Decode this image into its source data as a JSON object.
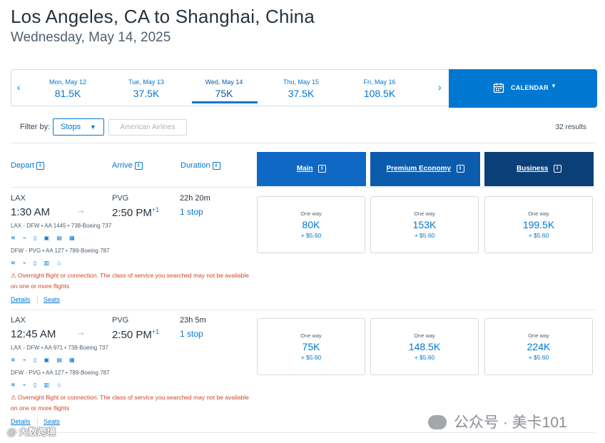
{
  "page": {
    "title": "Los Angeles, CA to Shanghai, China",
    "subtitle": "Wednesday, May 14, 2025"
  },
  "datebar": {
    "prev_glyph": "‹",
    "next_glyph": "›",
    "dates": [
      {
        "day": "Mon, May 12",
        "price": "81.5K"
      },
      {
        "day": "Tue, May 13",
        "price": "37.5K"
      },
      {
        "day": "Wed, May 14",
        "price": "75K"
      },
      {
        "day": "Thu, May 15",
        "price": "37.5K"
      },
      {
        "day": "Fri, May 16",
        "price": "108.5K"
      }
    ],
    "selected_index": 2,
    "calendar_label": "CALENDAR",
    "caret": "▼"
  },
  "filters": {
    "label": "Filter by:",
    "stops_value": "Stops",
    "caret": "▼",
    "airline_placeholder": "American Airlines",
    "results": "32 results"
  },
  "columns": {
    "depart": "Depart",
    "arrive": "Arrive",
    "duration": "Duration",
    "sort_glyph": "⇕",
    "cabins": [
      {
        "label": "Main",
        "color": "#0f68c4"
      },
      {
        "label": "Premium Economy",
        "color": "#0b5cad"
      },
      {
        "label": "Business",
        "color": "#0b3f78"
      }
    ]
  },
  "flights": [
    {
      "from": "LAX",
      "depart_time": "1:30 AM",
      "to": "PVG",
      "arrive_time": "2:50 PM",
      "day_offset": "+1",
      "duration": "22h 20m",
      "stops": "1 stop",
      "arrow": "→",
      "seg1": "LAX - DFW • AA 1445 • 738-Boeing 737",
      "seg1_amenities": "≋ ⌁ ▯ ▣ ▤ ▦",
      "seg2": "DFW - PVG • AA 127 • 789-Boeing 787",
      "seg2_amenities": "≋ ⌁ ▯ ▥ ♨",
      "warn_icon": "⚠",
      "warning": "Overnight flight or connection. The class of service you searched may not be available on one or more flights",
      "details": "Details",
      "seats": "Seats",
      "fares": [
        {
          "label": "One way",
          "points": "80K",
          "tax": "+ $5.60"
        },
        {
          "label": "One way",
          "points": "153K",
          "tax": "+ $5.60"
        },
        {
          "label": "One way",
          "points": "199.5K",
          "tax": "+ $5.60"
        }
      ]
    },
    {
      "from": "LAX",
      "depart_time": "12:45 AM",
      "to": "PVG",
      "arrive_time": "2:50 PM",
      "day_offset": "+1",
      "duration": "23h 5m",
      "stops": "1 stop",
      "arrow": "→",
      "seg1": "LAX - DFW • AA 971 • 738-Boeing 737",
      "seg1_amenities": "≋ ⌁ ▯ ▣ ▤ ▦",
      "seg2": "DFW - PVG • AA 127 • 789-Boeing 787",
      "seg2_amenities": "≋ ⌁ ▯ ▥ ♨",
      "warn_icon": "⚠",
      "warning": "Overnight flight or connection. The class of service you searched may not be available on one or more flights",
      "details": "Details",
      "seats": "Seats",
      "fares": [
        {
          "label": "One way",
          "points": "75K",
          "tax": "+ $5.60"
        },
        {
          "label": "One way",
          "points": "148.5K",
          "tax": "+ $5.60"
        },
        {
          "label": "One way",
          "points": "224K",
          "tax": "+ $5.60"
        }
      ]
    }
  ],
  "watermarks": {
    "wechat": "公众号 · 美卡101",
    "corner": "@ 大数跨境"
  }
}
